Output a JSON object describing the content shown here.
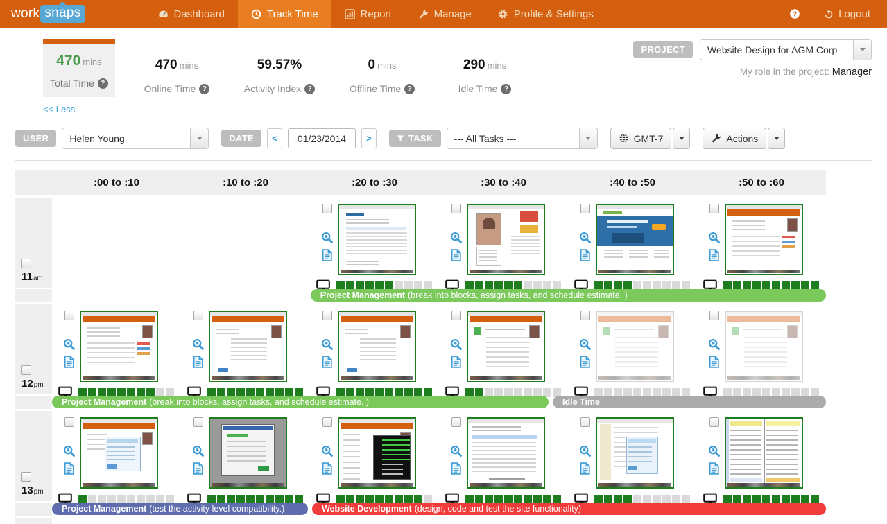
{
  "navbar": {
    "logo_part1": "work",
    "logo_part2": "snaps",
    "items": [
      {
        "label": "Dashboard",
        "icon": "dashboard-icon",
        "active": false
      },
      {
        "label": "Track Time",
        "icon": "clock-icon",
        "active": true
      },
      {
        "label": "Report",
        "icon": "report-icon",
        "active": false
      },
      {
        "label": "Manage",
        "icon": "wrench-icon",
        "active": false
      },
      {
        "label": "Profile & Settings",
        "icon": "gear-icon",
        "active": false
      }
    ],
    "logout_label": "Logout"
  },
  "stats": {
    "total": {
      "value": "470",
      "unit": "mins",
      "label": "Total Time"
    },
    "others": [
      {
        "value": "470",
        "unit": "mins",
        "label": "Online Time"
      },
      {
        "value": "59.57%",
        "unit": "",
        "label": "Activity Index"
      },
      {
        "value": "0",
        "unit": "mins",
        "label": "Offline Time"
      },
      {
        "value": "290",
        "unit": "mins",
        "label": "Idle Time"
      }
    ],
    "less_link": "<< Less"
  },
  "project": {
    "badge": "PROJECT",
    "selected": "Website Design for AGM Corp",
    "role_label": "My role in the project:",
    "role_value": "Manager"
  },
  "filters": {
    "user_badge": "USER",
    "user_selected": "Helen Young",
    "date_badge": "DATE",
    "prev": "<",
    "date_value": "01/23/2014",
    "next": ">",
    "task_badge": "TASK",
    "task_selected": "--- All Tasks ---",
    "timezone": "GMT-7",
    "actions": "Actions"
  },
  "colors": {
    "navbar_bg": "#D4600F",
    "navbar_active": "#E87E21",
    "logo_blue": "#58A7D4",
    "total_value_green": "#4A9B4A",
    "link_blue": "#3FA3DC",
    "icon_blue": "#3D9BD5",
    "activity_green": "#1E7D1E",
    "task_green": "#7CC95B",
    "idle_gray": "#ABABAB",
    "task_blue": "#5F6DAE",
    "task_red": "#F23B3B"
  },
  "grid": {
    "columns": [
      ":00 to :10",
      ":10 to :20",
      ":20 to :30",
      ":30 to :40",
      ":40 to :50",
      ":50 to :60"
    ],
    "rows": [
      {
        "hour": "11",
        "meridiem": "am",
        "cells": [
          null,
          null,
          {
            "state": "active",
            "variant": "webtable",
            "green": 6
          },
          {
            "state": "active",
            "variant": "video",
            "green": 6
          },
          {
            "state": "active",
            "variant": "bluesite",
            "green": 4
          },
          {
            "state": "active",
            "variant": "orange",
            "green": 10
          }
        ],
        "bars": [
          {
            "bold": "Project Management",
            "rest": "(break into blocks, assign tasks, and schedule estimate. )",
            "bg": "#7CC95B",
            "left_pct": 33.4,
            "width_pct": 66.6
          }
        ]
      },
      {
        "hour": "12",
        "meridiem": "pm",
        "cells": [
          {
            "state": "active",
            "variant": "orange",
            "green": 8
          },
          {
            "state": "active",
            "variant": "orangeform",
            "green": 10
          },
          {
            "state": "active",
            "variant": "orangeform",
            "green": 10
          },
          {
            "state": "active",
            "variant": "orangemail",
            "green": 2
          },
          {
            "state": "idle",
            "variant": "orangemail",
            "green": 0
          },
          {
            "state": "idle",
            "variant": "orangemail",
            "green": 0
          }
        ],
        "bars": [
          {
            "bold": "Project Management",
            "rest": "(break into blocks, assign tasks, and schedule estimate. )",
            "bg": "#7CC95B",
            "left_pct": 0,
            "width_pct": 64.2
          },
          {
            "bold": "Idle Time",
            "rest": "",
            "bg": "#ABABAB",
            "left_pct": 64.7,
            "width_pct": 35.3
          }
        ]
      },
      {
        "hour": "13",
        "meridiem": "pm",
        "cells": [
          {
            "state": "active",
            "variant": "orangedialog",
            "green": 1
          },
          {
            "state": "active",
            "variant": "graydesk",
            "green": 10
          },
          {
            "state": "active",
            "variant": "terminal",
            "green": 9
          },
          {
            "state": "active",
            "variant": "filelist",
            "green": 10
          },
          {
            "state": "active",
            "variant": "filedialog",
            "green": 4
          },
          {
            "state": "active",
            "variant": "code",
            "green": 10
          }
        ],
        "bars": [
          {
            "bold": "Project Management",
            "rest": "(test the activity level compatibility.)",
            "bg": "#5F6DAE",
            "left_pct": 0,
            "width_pct": 33.1
          },
          {
            "bold": "Website Development",
            "rest": "(design, code and test the site functionality)",
            "bg": "#F23B3B",
            "left_pct": 33.6,
            "width_pct": 66.4
          }
        ]
      }
    ]
  }
}
